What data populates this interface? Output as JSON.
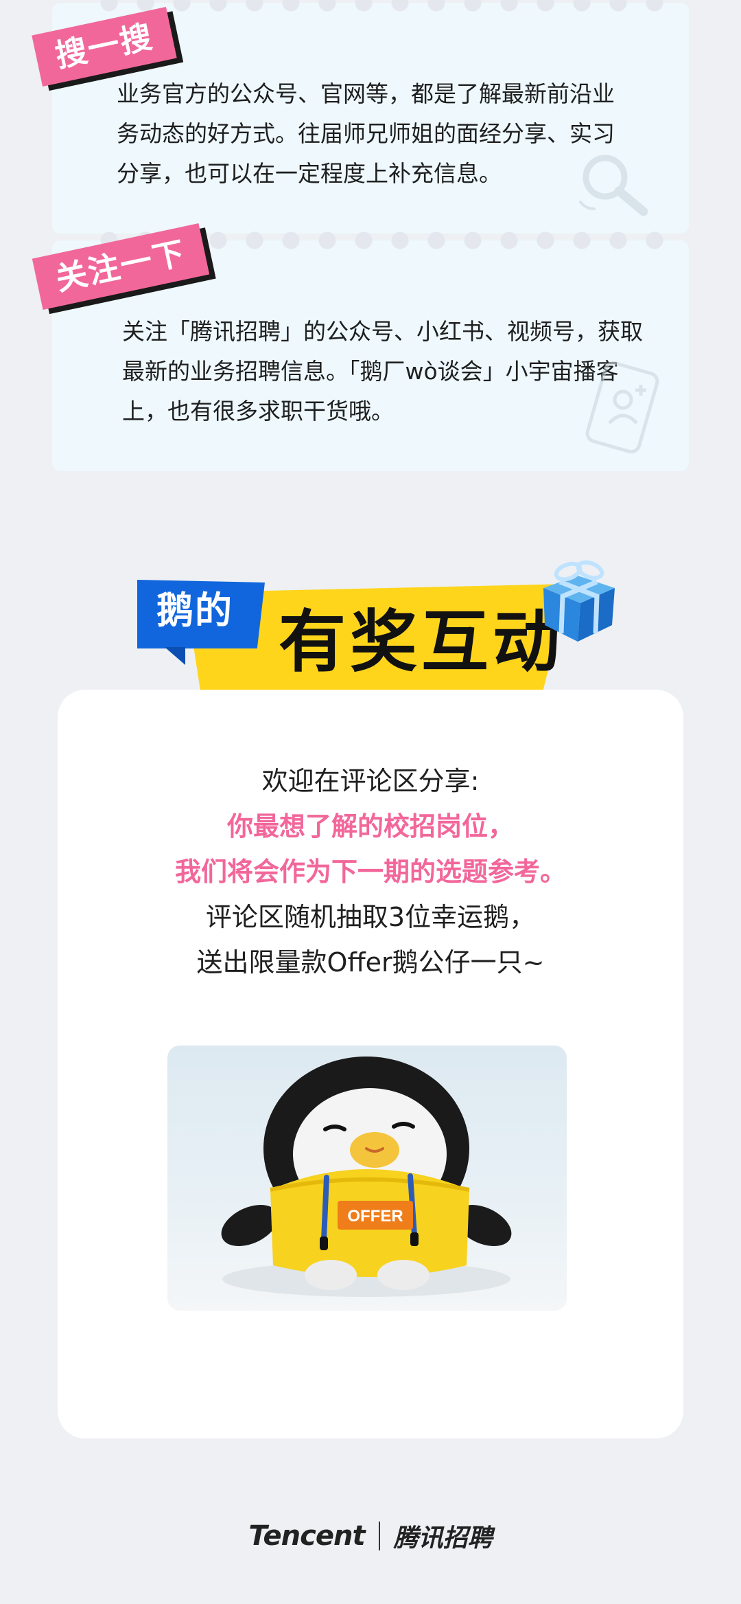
{
  "search_card": {
    "tag": "搜一搜",
    "lines": [
      "业务官方的公众号、官网等，都是了解最新前沿业",
      "务动态的好方式。往届师兄师姐的面经分享、实习",
      "分享，也可以在一定程度上补充信息。"
    ],
    "icon": "magnifier-icon"
  },
  "follow_card": {
    "tag": "关注一下",
    "lines": [
      "关注「腾讯招聘」的公众号、小红书、视频号，获取",
      "最新的业务招聘信息。「鹅厂wò谈会」小宇宙播客",
      "上，也有很多求职干货哦。"
    ],
    "icon": "phone-user-icon"
  },
  "header": {
    "badge": "鹅的",
    "title": "有奖互动",
    "icon": "gift-box-icon",
    "colors": {
      "badge": "#1166dd",
      "banner": "#ffd51c"
    }
  },
  "interaction": {
    "line1": "欢迎在评论区分享:",
    "highlight1": "你最想了解的校招岗位，",
    "highlight2": "我们将会作为下一期的选题参考。",
    "line4": "评论区随机抽取3位幸运鹅，",
    "line5": "送出限量款Offer鹅公仔一只~",
    "accent": "#f2679a"
  },
  "photo": {
    "hoodie_text": "OFFER"
  },
  "footer": {
    "logo": "Tencent",
    "brand": "腾讯招聘"
  }
}
